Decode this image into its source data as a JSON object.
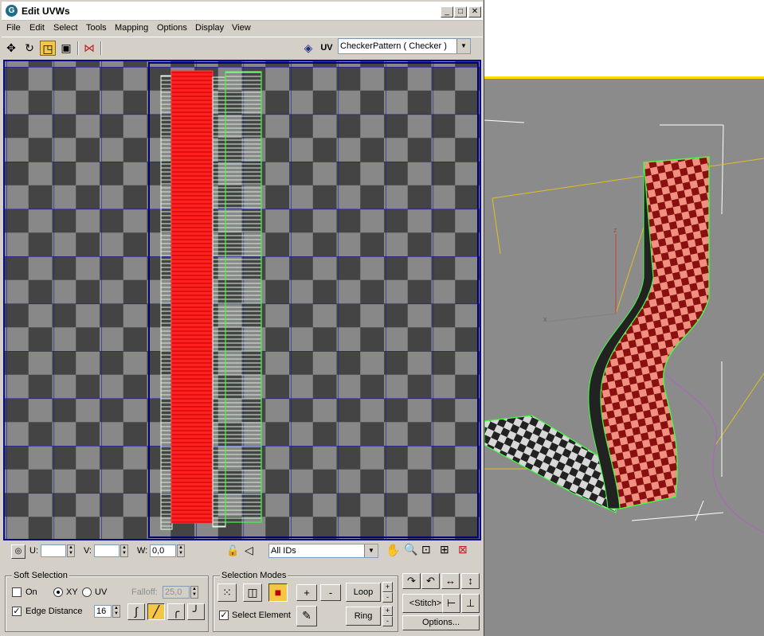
{
  "window": {
    "title": "Edit UVWs",
    "minimize": "_",
    "maximize": "□",
    "close": "✕"
  },
  "menu": [
    "File",
    "Edit",
    "Select",
    "Tools",
    "Mapping",
    "Options",
    "Display",
    "View"
  ],
  "toolbar": {
    "uv_label": "UV",
    "texture_select": "CheckerPattern  ( Checker )"
  },
  "status": {
    "u_label": "U:",
    "v_label": "V:",
    "w_label": "W:",
    "u_value": "",
    "v_value": "",
    "w_value": "0,0",
    "id_filter": "All IDs"
  },
  "soft_selection": {
    "title": "Soft Selection",
    "on_label": "On",
    "on_checked": false,
    "xy_label": "XY",
    "uv_label": "UV",
    "mode": "XY",
    "falloff_label": "Falloff:",
    "falloff_value": "25,0",
    "edge_distance_label": "Edge Distance",
    "edge_distance_checked": true,
    "edge_distance_value": "16"
  },
  "selection_modes": {
    "title": "Selection Modes",
    "plus": "+",
    "minus": "-",
    "loop_label": "Loop",
    "ring_label": "Ring",
    "select_element_label": "Select Element",
    "select_element_checked": true
  },
  "tools_panel": {
    "stitch_label": "Stitch",
    "stitch_left": "<",
    "stitch_right": ">",
    "options_label": "Options..."
  },
  "viewport": {
    "axis_z": "z",
    "axis_x": "x",
    "axis_y": "y"
  },
  "colors": {
    "selection_red": "#ff2020",
    "grid_blue": "#1010a0",
    "edge_green": "#40ff40",
    "highlight_orange": "#f3c646"
  }
}
